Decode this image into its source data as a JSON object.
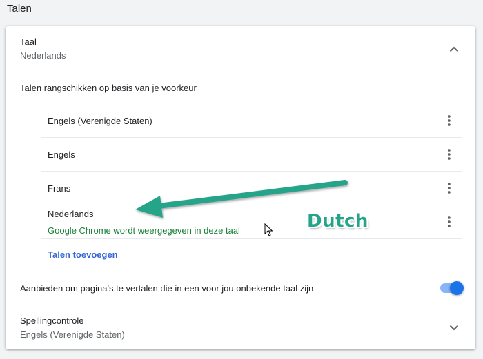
{
  "section": {
    "title": "Talen"
  },
  "language": {
    "label": "Taal",
    "value": "Nederlands",
    "order_heading": "Talen rangschikken op basis van je voorkeur",
    "items": [
      {
        "name": "Engels (Verenigde Staten)"
      },
      {
        "name": "Engels"
      },
      {
        "name": "Frans"
      },
      {
        "name": "Nederlands",
        "note": "Google Chrome wordt weergegeven in deze taal"
      }
    ],
    "add_label": "Talen toevoegen"
  },
  "translate": {
    "label": "Aanbieden om pagina's te vertalen die in een voor jou onbekende taal zijn",
    "enabled": true
  },
  "spellcheck": {
    "label": "Spellingcontrole",
    "value": "Engels (Verenigde Staten)"
  },
  "annotation": {
    "text": "Dutch",
    "color": "#26a48a"
  },
  "colors": {
    "accent": "#1a73e8",
    "link": "#3367d6",
    "note_green": "#188038"
  }
}
